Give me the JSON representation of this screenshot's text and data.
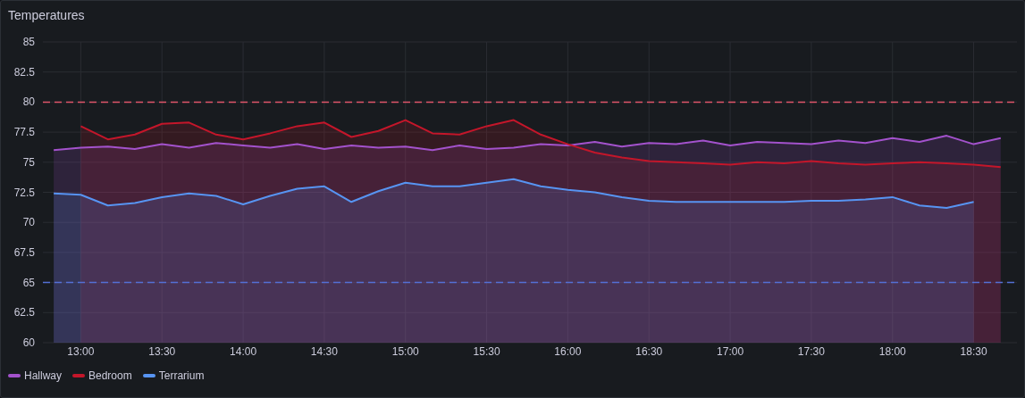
{
  "panel": {
    "title": "Temperatures",
    "chart_data": {
      "type": "area",
      "grid": true,
      "x": [
        770,
        780,
        790,
        800,
        810,
        820,
        830,
        840,
        850,
        860,
        870,
        880,
        890,
        900,
        910,
        920,
        930,
        940,
        950,
        960,
        970,
        980,
        990,
        1000,
        1010,
        1020,
        1030,
        1040,
        1050,
        1060,
        1070,
        1080,
        1090,
        1100,
        1110,
        1120
      ],
      "series": [
        {
          "name": "Hallway",
          "color": "#a352cc",
          "values": [
            76.0,
            76.2,
            76.3,
            76.1,
            76.5,
            76.2,
            76.6,
            76.4,
            76.2,
            76.5,
            76.1,
            76.4,
            76.2,
            76.3,
            76.0,
            76.4,
            76.1,
            76.2,
            76.5,
            76.4,
            76.7,
            76.3,
            76.6,
            76.5,
            76.8,
            76.4,
            76.7,
            76.6,
            76.5,
            76.8,
            76.6,
            77.0,
            76.7,
            77.2,
            76.5,
            77.0
          ]
        },
        {
          "name": "Bedroom",
          "color": "#c4162a",
          "values": [
            null,
            78.0,
            76.9,
            77.3,
            78.2,
            78.3,
            77.3,
            76.9,
            77.4,
            78.0,
            78.3,
            77.1,
            77.6,
            78.5,
            77.4,
            77.3,
            78.0,
            78.5,
            77.3,
            76.5,
            75.8,
            75.4,
            75.1,
            75.0,
            74.9,
            74.8,
            75.0,
            74.9,
            75.1,
            74.9,
            74.8,
            74.9,
            75.0,
            74.9,
            74.8,
            74.6
          ]
        },
        {
          "name": "Terrarium",
          "color": "#5794f2",
          "values": [
            72.4,
            72.3,
            71.4,
            71.6,
            72.1,
            72.4,
            72.2,
            71.5,
            72.2,
            72.8,
            73.0,
            71.7,
            72.6,
            73.3,
            73.0,
            73.0,
            73.3,
            73.6,
            73.0,
            72.7,
            72.5,
            72.1,
            71.8,
            71.7,
            71.7,
            71.7,
            71.7,
            71.7,
            71.8,
            71.8,
            71.9,
            72.1,
            71.4,
            71.2,
            71.7,
            null
          ]
        }
      ],
      "xlim": [
        766,
        1126
      ],
      "ylim": [
        60,
        85
      ],
      "yticks": [
        60,
        62.5,
        65,
        67.5,
        70,
        72.5,
        75,
        77.5,
        80,
        82.5,
        85
      ],
      "xticks": [
        {
          "value": 780,
          "label": "13:00"
        },
        {
          "value": 810,
          "label": "13:30"
        },
        {
          "value": 840,
          "label": "14:00"
        },
        {
          "value": 870,
          "label": "14:30"
        },
        {
          "value": 900,
          "label": "15:00"
        },
        {
          "value": 930,
          "label": "15:30"
        },
        {
          "value": 960,
          "label": "16:00"
        },
        {
          "value": 990,
          "label": "16:30"
        },
        {
          "value": 1020,
          "label": "17:00"
        },
        {
          "value": 1050,
          "label": "17:30"
        },
        {
          "value": 1080,
          "label": "18:00"
        },
        {
          "value": 1110,
          "label": "18:30"
        }
      ],
      "ref_lines": [
        {
          "axis": "y",
          "value": 80,
          "color": "#e0566a"
        },
        {
          "axis": "y",
          "value": 65,
          "color": "#5470d6"
        }
      ]
    }
  }
}
